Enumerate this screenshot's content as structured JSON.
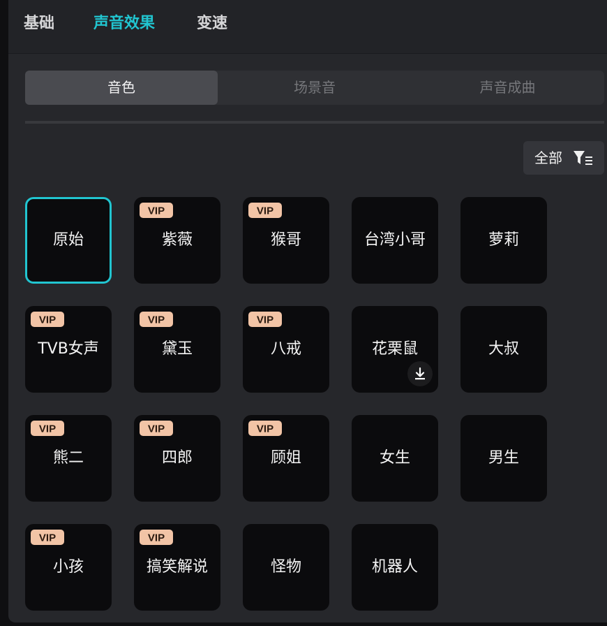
{
  "top_tabs": [
    {
      "label": "基础",
      "active": false
    },
    {
      "label": "声音效果",
      "active": true
    },
    {
      "label": "变速",
      "active": false
    }
  ],
  "segment_tabs": [
    {
      "label": "音色",
      "active": true
    },
    {
      "label": "场景音",
      "active": false
    },
    {
      "label": "声音成曲",
      "active": false
    }
  ],
  "filter": {
    "label": "全部",
    "icon": "filter-list-icon"
  },
  "badge_text": "VIP",
  "voices": [
    {
      "name": "原始",
      "vip": false,
      "selected": true,
      "download": false
    },
    {
      "name": "紫薇",
      "vip": true,
      "selected": false,
      "download": false
    },
    {
      "name": "猴哥",
      "vip": true,
      "selected": false,
      "download": false
    },
    {
      "name": "台湾小哥",
      "vip": false,
      "selected": false,
      "download": false
    },
    {
      "name": "萝莉",
      "vip": false,
      "selected": false,
      "download": false
    },
    {
      "name": "TVB女声",
      "vip": true,
      "selected": false,
      "download": false
    },
    {
      "name": "黛玉",
      "vip": true,
      "selected": false,
      "download": false
    },
    {
      "name": "八戒",
      "vip": true,
      "selected": false,
      "download": false
    },
    {
      "name": "花栗鼠",
      "vip": false,
      "selected": false,
      "download": true
    },
    {
      "name": "大叔",
      "vip": false,
      "selected": false,
      "download": false
    },
    {
      "name": "熊二",
      "vip": true,
      "selected": false,
      "download": false
    },
    {
      "name": "四郎",
      "vip": true,
      "selected": false,
      "download": false
    },
    {
      "name": "顾姐",
      "vip": true,
      "selected": false,
      "download": false
    },
    {
      "name": "女生",
      "vip": false,
      "selected": false,
      "download": false
    },
    {
      "name": "男生",
      "vip": false,
      "selected": false,
      "download": false
    },
    {
      "name": "小孩",
      "vip": true,
      "selected": false,
      "download": false
    },
    {
      "name": "搞笑解说",
      "vip": true,
      "selected": false,
      "download": false
    },
    {
      "name": "怪物",
      "vip": false,
      "selected": false,
      "download": false
    },
    {
      "name": "机器人",
      "vip": false,
      "selected": false,
      "download": false
    }
  ],
  "colors": {
    "accent": "#21c5d0",
    "vip_badge": "#f2c4a6",
    "card_bg": "#0b0b0d"
  }
}
